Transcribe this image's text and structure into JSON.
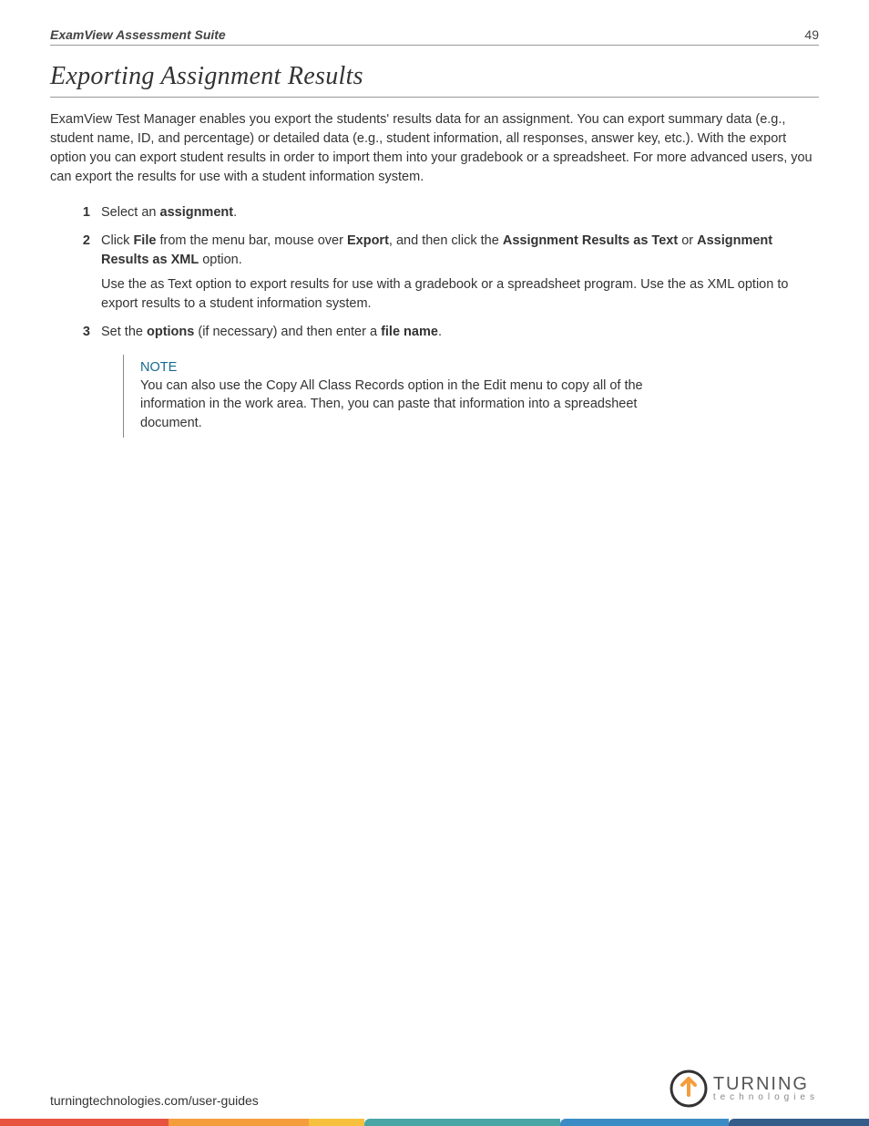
{
  "header": {
    "doc_title": "ExamView Assessment Suite",
    "page_number": "49"
  },
  "section": {
    "title": "Exporting Assignment Results",
    "intro": "ExamView Test Manager enables you export the students' results data for an assignment. You can export summary data (e.g., student name, ID, and percentage) or detailed data (e.g., student information, all responses, answer key, etc.). With the export option you can export student results in order to import them into your gradebook or a spreadsheet. For more advanced users, you can export the results for use with a student information system."
  },
  "steps": [
    {
      "num": "1",
      "pre": "Select an ",
      "bold1": "assignment",
      "post": "."
    },
    {
      "num": "2",
      "pre": "Click ",
      "bold1": "File",
      "mid1": " from the menu bar, mouse over ",
      "bold2": "Export",
      "mid2": ", and then click the ",
      "bold3": "Assignment Results as Text",
      "mid3": " or ",
      "bold4": "Assignment Results as XML",
      "post": " option.",
      "extra": "Use the as Text option to export results for use with a gradebook or a spreadsheet program. Use the as XML option to export results to a student information system."
    },
    {
      "num": "3",
      "pre": "Set the ",
      "bold1": "options",
      "mid1": " (if necessary) and then enter a ",
      "bold2": "file name",
      "post": "."
    }
  ],
  "note": {
    "title": "NOTE",
    "body": "You can also use the Copy All Class Records option in the Edit menu to copy all of the information in the work area. Then, you can paste that information into a spreadsheet document."
  },
  "footer": {
    "url": "turningtechnologies.com/user-guides",
    "logo_main": "TURNING",
    "logo_sub": "technologies"
  }
}
